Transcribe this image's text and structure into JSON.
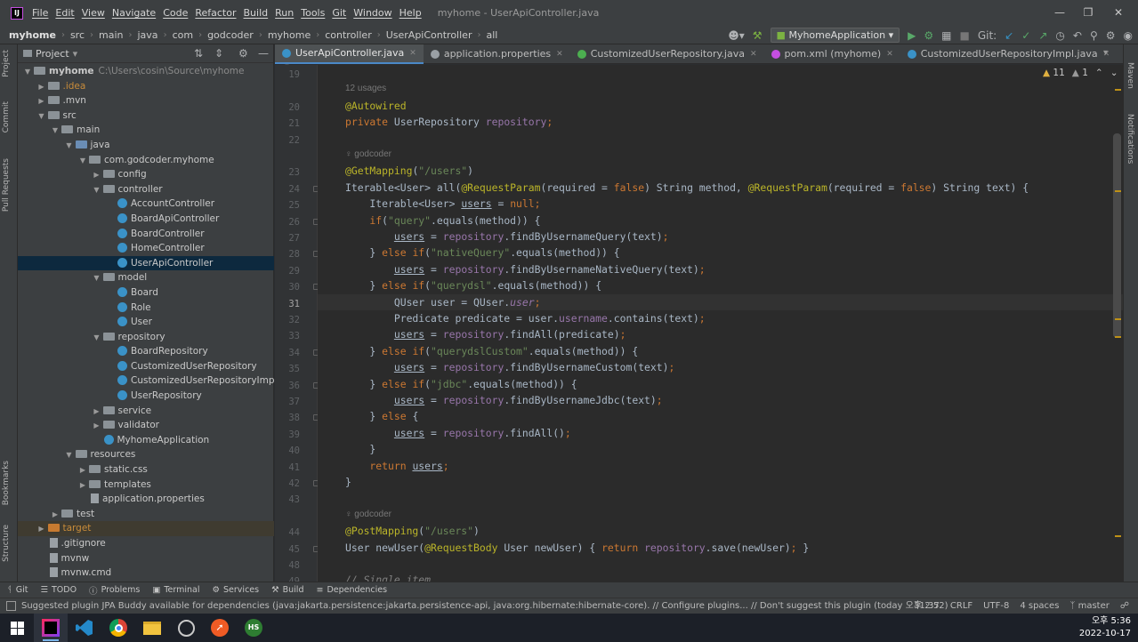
{
  "app": {
    "title": "myhome - UserApiController.java",
    "logo_text": "IJ"
  },
  "menu": [
    "File",
    "Edit",
    "View",
    "Navigate",
    "Code",
    "Refactor",
    "Build",
    "Run",
    "Tools",
    "Git",
    "Window",
    "Help"
  ],
  "breadcrumb": [
    "myhome",
    "src",
    "main",
    "java",
    "com",
    "godcoder",
    "myhome",
    "controller",
    "UserApiController",
    "all"
  ],
  "toolbar": {
    "run_config": "MyhomeApplication",
    "git_label": "Git:"
  },
  "project": {
    "title": "Project"
  },
  "tree": [
    {
      "level": 0,
      "arrow": "down",
      "icon": "folder",
      "name": "myhome",
      "hint": "C:\\Users\\cosin\\Source\\myhome",
      "bold": true
    },
    {
      "level": 1,
      "arrow": "right",
      "icon": "folder",
      "name": ".idea",
      "color": "#c98c3a"
    },
    {
      "level": 1,
      "arrow": "right",
      "icon": "folder",
      "name": ".mvn"
    },
    {
      "level": 1,
      "arrow": "down",
      "icon": "folder",
      "name": "src"
    },
    {
      "level": 2,
      "arrow": "down",
      "icon": "folder",
      "name": "main"
    },
    {
      "level": 3,
      "arrow": "down",
      "icon": "folder-blue",
      "name": "java"
    },
    {
      "level": 4,
      "arrow": "down",
      "icon": "folder",
      "name": "com.godcoder.myhome"
    },
    {
      "level": 5,
      "arrow": "right",
      "icon": "folder",
      "name": "config"
    },
    {
      "level": 5,
      "arrow": "down",
      "icon": "folder",
      "name": "controller"
    },
    {
      "level": 6,
      "arrow": "",
      "icon": "class",
      "name": "AccountController"
    },
    {
      "level": 6,
      "arrow": "",
      "icon": "class",
      "name": "BoardApiController"
    },
    {
      "level": 6,
      "arrow": "",
      "icon": "class",
      "name": "BoardController"
    },
    {
      "level": 6,
      "arrow": "",
      "icon": "class",
      "name": "HomeController"
    },
    {
      "level": 6,
      "arrow": "",
      "icon": "class",
      "name": "UserApiController",
      "selected": true
    },
    {
      "level": 5,
      "arrow": "down",
      "icon": "folder",
      "name": "model"
    },
    {
      "level": 6,
      "arrow": "",
      "icon": "class",
      "name": "Board"
    },
    {
      "level": 6,
      "arrow": "",
      "icon": "class",
      "name": "Role"
    },
    {
      "level": 6,
      "arrow": "",
      "icon": "class",
      "name": "User"
    },
    {
      "level": 5,
      "arrow": "down",
      "icon": "folder",
      "name": "repository"
    },
    {
      "level": 6,
      "arrow": "",
      "icon": "class",
      "name": "BoardRepository"
    },
    {
      "level": 6,
      "arrow": "",
      "icon": "class",
      "name": "CustomizedUserRepository"
    },
    {
      "level": 6,
      "arrow": "",
      "icon": "class",
      "name": "CustomizedUserRepositoryImpl"
    },
    {
      "level": 6,
      "arrow": "",
      "icon": "class",
      "name": "UserRepository"
    },
    {
      "level": 5,
      "arrow": "right",
      "icon": "folder",
      "name": "service"
    },
    {
      "level": 5,
      "arrow": "right",
      "icon": "folder",
      "name": "validator"
    },
    {
      "level": 5,
      "arrow": "",
      "icon": "class",
      "name": "MyhomeApplication"
    },
    {
      "level": 3,
      "arrow": "down",
      "icon": "folder",
      "name": "resources"
    },
    {
      "level": 4,
      "arrow": "right",
      "icon": "folder",
      "name": "static.css"
    },
    {
      "level": 4,
      "arrow": "right",
      "icon": "folder",
      "name": "templates"
    },
    {
      "level": 4,
      "arrow": "",
      "icon": "file",
      "name": "application.properties"
    },
    {
      "level": 2,
      "arrow": "right",
      "icon": "folder",
      "name": "test"
    },
    {
      "level": 1,
      "arrow": "right",
      "icon": "folder-orange",
      "name": "target",
      "excluded": true
    },
    {
      "level": 1,
      "arrow": "",
      "icon": "file",
      "name": ".gitignore"
    },
    {
      "level": 1,
      "arrow": "",
      "icon": "file",
      "name": "mvnw"
    },
    {
      "level": 1,
      "arrow": "",
      "icon": "file",
      "name": "mvnw.cmd"
    }
  ],
  "tabs": [
    {
      "label": "UserApiController.java",
      "color": "#3a92c7",
      "active": true
    },
    {
      "label": "application.properties",
      "color": "#9aa0a5"
    },
    {
      "label": "CustomizedUserRepository.java",
      "color": "#4caf50"
    },
    {
      "label": "pom.xml (myhome)",
      "color": "#c54fe0"
    },
    {
      "label": "CustomizedUserRepositoryImpl.java",
      "color": "#3a92c7"
    }
  ],
  "inspections": {
    "warnings": "11",
    "weak": "1"
  },
  "code": [
    {
      "n": "19",
      "t": []
    },
    {
      "n": "",
      "inlay": "12 usages"
    },
    {
      "n": "20",
      "t": [
        [
          "a",
          "@Autowired"
        ]
      ]
    },
    {
      "n": "21",
      "t": [
        [
          "k",
          "private "
        ],
        [
          "",
          "UserRepository "
        ],
        [
          "f",
          "repository"
        ],
        [
          "k",
          ";"
        ]
      ]
    },
    {
      "n": "22",
      "t": []
    },
    {
      "n": "",
      "inlay": "♀ godcoder"
    },
    {
      "n": "23",
      "t": [
        [
          "a",
          "@GetMapping"
        ],
        [
          "",
          "("
        ],
        [
          "s",
          "\"/users\""
        ],
        [
          "",
          ")"
        ]
      ]
    },
    {
      "n": "24",
      "fold": true,
      "t": [
        [
          "",
          "Iterable<User> "
        ],
        [
          "",
          "all("
        ],
        [
          "a",
          "@RequestParam"
        ],
        [
          "",
          "(required = "
        ],
        [
          "k",
          "false"
        ],
        [
          "",
          ") String method, "
        ],
        [
          "a",
          "@RequestParam"
        ],
        [
          "",
          "(required = "
        ],
        [
          "k",
          "false"
        ],
        [
          "",
          ") String text) {"
        ]
      ]
    },
    {
      "n": "25",
      "t": [
        [
          "",
          "    Iterable<User> "
        ],
        [
          "u",
          "users"
        ],
        [
          "",
          " = "
        ],
        [
          "k",
          "null"
        ],
        [
          "k",
          ";"
        ]
      ]
    },
    {
      "n": "26",
      "fold": true,
      "t": [
        [
          "k",
          "    if"
        ],
        [
          "",
          "("
        ],
        [
          "s",
          "\"query\""
        ],
        [
          "",
          ".equals(method)) {"
        ]
      ]
    },
    {
      "n": "27",
      "t": [
        [
          "",
          "        "
        ],
        [
          "u",
          "users"
        ],
        [
          "",
          " = "
        ],
        [
          "f",
          "repository"
        ],
        [
          "",
          ".findByUsernameQuery(text)"
        ],
        [
          "k",
          ";"
        ]
      ]
    },
    {
      "n": "28",
      "fold": true,
      "t": [
        [
          "",
          "    } "
        ],
        [
          "k",
          "else if"
        ],
        [
          "",
          "("
        ],
        [
          "s",
          "\"nativeQuery\""
        ],
        [
          "",
          ".equals(method)) {"
        ]
      ]
    },
    {
      "n": "29",
      "t": [
        [
          "",
          "        "
        ],
        [
          "u",
          "users"
        ],
        [
          "",
          " = "
        ],
        [
          "f",
          "repository"
        ],
        [
          "",
          ".findByUsernameNativeQuery(text)"
        ],
        [
          "k",
          ";"
        ]
      ]
    },
    {
      "n": "30",
      "fold": true,
      "t": [
        [
          "",
          "    } "
        ],
        [
          "k",
          "else if"
        ],
        [
          "",
          "("
        ],
        [
          "s",
          "\"querydsl\""
        ],
        [
          "",
          ".equals(method)) {"
        ]
      ]
    },
    {
      "n": "31",
      "cur": true,
      "t": [
        [
          "",
          "        QUser user = QUser."
        ],
        [
          "fi",
          "user"
        ],
        [
          "k",
          ";"
        ]
      ]
    },
    {
      "n": "32",
      "t": [
        [
          "",
          "        Predicate predicate = user."
        ],
        [
          "f",
          "username"
        ],
        [
          "",
          ".contains(text)"
        ],
        [
          "k",
          ";"
        ]
      ]
    },
    {
      "n": "33",
      "t": [
        [
          "",
          "        "
        ],
        [
          "u",
          "users"
        ],
        [
          "",
          " = "
        ],
        [
          "f",
          "repository"
        ],
        [
          "",
          ".findAll(predicate)"
        ],
        [
          "k",
          ";"
        ]
      ]
    },
    {
      "n": "34",
      "fold": true,
      "t": [
        [
          "",
          "    } "
        ],
        [
          "k",
          "else if"
        ],
        [
          "",
          "("
        ],
        [
          "s",
          "\"querydslCustom\""
        ],
        [
          "",
          ".equals(method)) {"
        ]
      ]
    },
    {
      "n": "35",
      "t": [
        [
          "",
          "        "
        ],
        [
          "u",
          "users"
        ],
        [
          "",
          " = "
        ],
        [
          "f",
          "repository"
        ],
        [
          "",
          ".findByUsernameCustom(text)"
        ],
        [
          "k",
          ";"
        ]
      ]
    },
    {
      "n": "36",
      "fold": true,
      "t": [
        [
          "",
          "    } "
        ],
        [
          "k",
          "else if"
        ],
        [
          "",
          "("
        ],
        [
          "s",
          "\"jdbc\""
        ],
        [
          "",
          ".equals(method)) {"
        ]
      ]
    },
    {
      "n": "37",
      "t": [
        [
          "",
          "        "
        ],
        [
          "u",
          "users"
        ],
        [
          "",
          " = "
        ],
        [
          "f",
          "repository"
        ],
        [
          "",
          ".findByUsernameJdbc(text)"
        ],
        [
          "k",
          ";"
        ]
      ]
    },
    {
      "n": "38",
      "fold": true,
      "t": [
        [
          "",
          "    } "
        ],
        [
          "k",
          "else "
        ],
        [
          "",
          "{"
        ]
      ]
    },
    {
      "n": "39",
      "t": [
        [
          "",
          "        "
        ],
        [
          "u",
          "users"
        ],
        [
          "",
          " = "
        ],
        [
          "f",
          "repository"
        ],
        [
          "",
          ".findAll()"
        ],
        [
          "k",
          ";"
        ]
      ]
    },
    {
      "n": "40",
      "t": [
        [
          "",
          "    }"
        ]
      ]
    },
    {
      "n": "41",
      "t": [
        [
          "k",
          "    return "
        ],
        [
          "u",
          "users"
        ],
        [
          "k",
          ";"
        ]
      ]
    },
    {
      "n": "42",
      "fold": true,
      "t": [
        [
          "",
          "}"
        ]
      ]
    },
    {
      "n": "43",
      "t": []
    },
    {
      "n": "",
      "inlay": "♀ godcoder"
    },
    {
      "n": "44",
      "t": [
        [
          "a",
          "@PostMapping"
        ],
        [
          "",
          "("
        ],
        [
          "s",
          "\"/users\""
        ],
        [
          "",
          ")"
        ]
      ]
    },
    {
      "n": "45",
      "fold": true,
      "t": [
        [
          "",
          "User "
        ],
        [
          "",
          "newUser("
        ],
        [
          "a",
          "@RequestBody "
        ],
        [
          "",
          "User newUser) { "
        ],
        [
          "k",
          "return "
        ],
        [
          "f",
          "repository"
        ],
        [
          "",
          ".save(newUser)"
        ],
        [
          "k",
          "; "
        ],
        [
          "",
          "}"
        ]
      ]
    },
    {
      "n": "48",
      "t": []
    },
    {
      "n": "49",
      "t": [
        [
          "c",
          "// Single item"
        ]
      ]
    }
  ],
  "bottom_tools": [
    "Git",
    "TODO",
    "Problems",
    "Terminal",
    "Services",
    "Build",
    "Dependencies"
  ],
  "status": {
    "message": "Suggested plugin JPA Buddy available for dependencies (java:jakarta.persistence:jakarta.persistence-api, java:org.hibernate:hibernate-core). // Configure plugins... // Don't suggest this plugin (today 오후 2:52)",
    "position": "31:37",
    "line_sep": "CRLF",
    "encoding": "UTF-8",
    "indent": "4 spaces",
    "branch": "master"
  },
  "side_tabs": {
    "left": [
      "Project",
      "Commit",
      "Pull Requests",
      "Bookmarks",
      "Structure"
    ],
    "right": [
      "Maven",
      "Notifications"
    ]
  },
  "taskbar": {
    "time": "오후 5:36",
    "date": "2022-10-17",
    "hs_label": "HS"
  }
}
